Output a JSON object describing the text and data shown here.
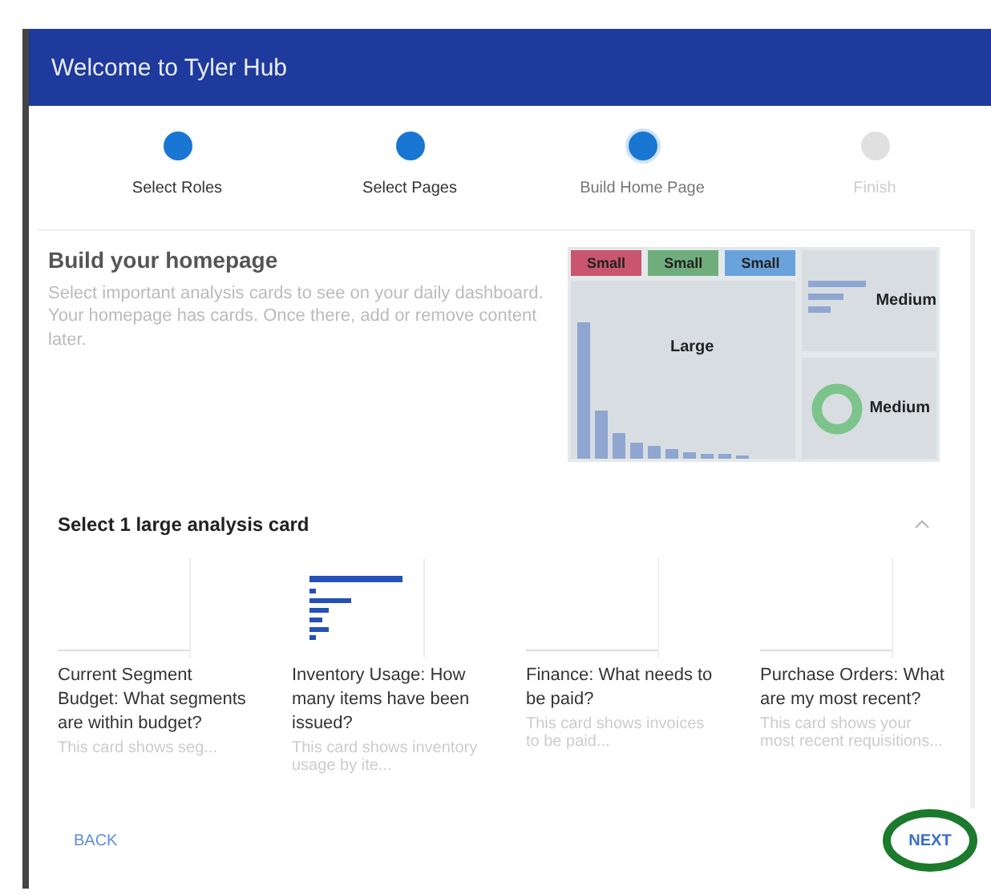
{
  "dialog": {
    "title": "Welcome to Tyler Hub"
  },
  "steps": [
    {
      "label": "Select Roles",
      "completed": true,
      "selected": false
    },
    {
      "label": "Select Pages",
      "completed": true,
      "selected": false
    },
    {
      "label": "Build Home Page",
      "completed": false,
      "selected": true
    },
    {
      "label": "Finish",
      "completed": false,
      "selected": false
    }
  ],
  "intro": {
    "heading": "Build your homepage",
    "text": "Select important analysis cards to see on your daily dashboard. Your homepage has cards. Once there, add or remove content later."
  },
  "preview": {
    "tiles": [
      {
        "label": "Small",
        "kind": "small",
        "color": "#c9566e"
      },
      {
        "label": "Small",
        "kind": "small",
        "color": "#6fae7c"
      },
      {
        "label": "Small",
        "kind": "small",
        "color": "#6aa3dc"
      },
      {
        "label": "Large",
        "kind": "large"
      },
      {
        "label": "Medium",
        "kind": "medium"
      },
      {
        "label": "Medium",
        "kind": "medium"
      }
    ]
  },
  "picker": {
    "heading": "Select 1 large analysis card",
    "cards": [
      {
        "kind": "blank",
        "title": "Current Segment Budget: What segments are within budget?",
        "text": "This card shows seg..."
      },
      {
        "kind": "bars",
        "title": "Inventory Usage: How many items have been issued?",
        "text": "This card shows inventory usage by ite..."
      },
      {
        "kind": "blank",
        "title": "Finance: What needs to be paid?",
        "text": "This card shows invoices to be paid..."
      },
      {
        "kind": "blank",
        "title": "Purchase Orders: What are my most recent?",
        "text": "This card shows your most recent requisitions..."
      }
    ]
  },
  "footer": {
    "back": "BACK",
    "next": "NEXT"
  }
}
